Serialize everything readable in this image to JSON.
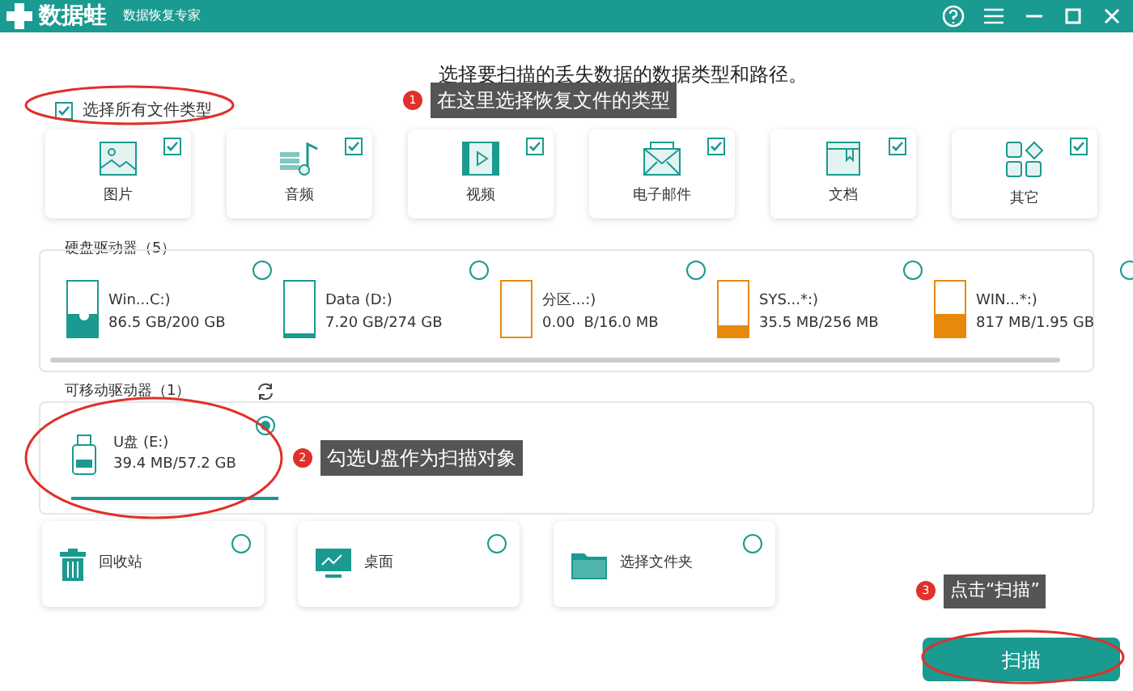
{
  "window": {
    "title": "数据蛙",
    "subtitle": "数据恢复专家"
  },
  "heading": "选择要扫描的丢失数据的数据类型和路径。",
  "select_all": {
    "label": "选择所有文件类型",
    "checked": true
  },
  "file_types": [
    {
      "label": "图片",
      "checked": true
    },
    {
      "label": "音频",
      "checked": true
    },
    {
      "label": "视频",
      "checked": true
    },
    {
      "label": "电子邮件",
      "checked": true
    },
    {
      "label": "文档",
      "checked": true
    },
    {
      "label": "其它",
      "checked": true
    }
  ],
  "hard_drives": {
    "title": "硬盘驱动器（5）",
    "items": [
      {
        "name": "Win...C:)",
        "size": "86.5 GB/200 GB",
        "level": 0.4,
        "color": "#1a9a90",
        "system": true,
        "selected": false
      },
      {
        "name": "Data (D:)",
        "size": "7.20 GB/274 GB",
        "level": 0.05,
        "color": "#1a9a90",
        "system": false,
        "selected": false
      },
      {
        "name": "分区...:)",
        "size": "0.00  B/16.0 MB",
        "level": 0,
        "color": "#e8890c",
        "system": false,
        "selected": false
      },
      {
        "name": "SYS...*:)",
        "size": "35.5 MB/256 MB",
        "level": 0.2,
        "color": "#e8890c",
        "system": false,
        "selected": false
      },
      {
        "name": "WIN...*:)",
        "size": "817 MB/1.95 GB",
        "level": 0.4,
        "color": "#e8890c",
        "system": false,
        "selected": false
      }
    ]
  },
  "removable_drives": {
    "title": "可移动驱动器（1）",
    "items": [
      {
        "name": "U盘 (E:)",
        "size": "39.4 MB/57.2 GB",
        "selected": true
      }
    ]
  },
  "locations": [
    {
      "label": "回收站",
      "selected": false
    },
    {
      "label": "桌面",
      "selected": false
    },
    {
      "label": "选择文件夹",
      "selected": false
    }
  ],
  "scan_button": "扫描",
  "callouts": [
    {
      "number": "1",
      "text": "在这里选择恢复文件的类型"
    },
    {
      "number": "2",
      "text": "勾选U盘作为扫描对象"
    },
    {
      "number": "3",
      "text": "点击“扫描”"
    }
  ]
}
